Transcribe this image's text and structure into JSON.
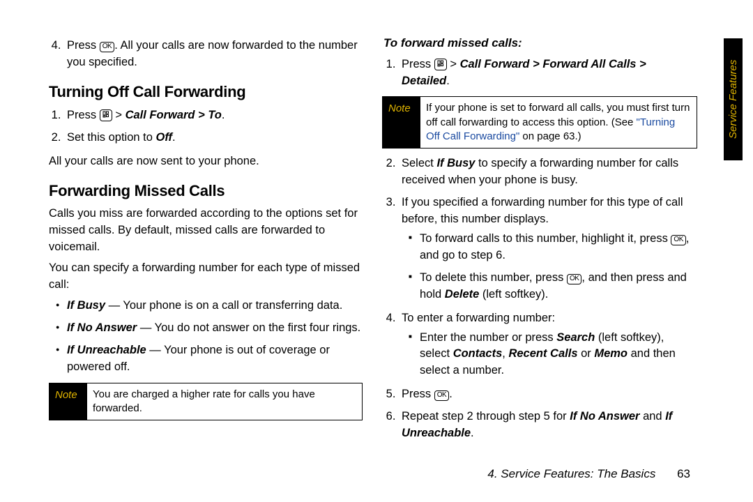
{
  "left": {
    "step4_pre": "Press ",
    "step4_key": "OK",
    "step4_post": ". All your calls are now forwarded to the number you specified.",
    "h_turnoff": "Turning Off Call Forwarding",
    "to_step1_pre": "Press ",
    "to_step1_key": "☐",
    "to_step1_mid": "  > ",
    "to_step1_bi": "Call Forward > To",
    "to_step1_post": ".",
    "to_step2_pre": "Set this option to ",
    "to_step2_bi": "Off",
    "to_step2_post": ".",
    "to_para": "All your calls are now sent to your phone.",
    "h_fmc": "Forwarding Missed Calls",
    "fmc_p1": "Calls you miss are forwarded according to the options set for missed calls. By default, missed calls are forwarded to voicemail.",
    "fmc_p2": "You can specify a forwarding number for each type of missed call:",
    "b1_label": "If Busy",
    "b1_text": " — Your phone is on a call or transferring data.",
    "b2_label": "If No Answer",
    "b2_text": " — You do not answer on the first four rings.",
    "b3_label": "If Unreachable",
    "b3_text": " — Your phone is out of coverage or powered off.",
    "note_label": "Note",
    "note_body": "You are charged a higher rate for calls you have forwarded."
  },
  "right": {
    "subhead": "To forward missed calls:",
    "s1_pre": "Press ",
    "s1_key": "☐",
    "s1_mid": "  > ",
    "s1_bi": "Call Forward > Forward All Calls > Detailed",
    "s1_post": ".",
    "note_label": "Note",
    "note_body_a": "If your phone is set to forward all calls, you must first turn off call forwarding to access this option. (See ",
    "note_body_ref1": "\"",
    "note_body_ref2": "Turning Off Call Forwarding",
    "note_body_ref3": "\"",
    "note_body_b": " on page 63.)",
    "s2_a": "Select ",
    "s2_bi": "If Busy",
    "s2_b": " to specify a forwarding number for calls received when your phone is busy.",
    "s3": "If you specified a forwarding number for this type of call before, this number displays.",
    "s3sq1_a": "To forward calls to this number, highlight it, press ",
    "s3sq1_key": "OK",
    "s3sq1_b": ", and go to step 6.",
    "s3sq2_a": "To delete this number, press ",
    "s3sq2_key": "OK",
    "s3sq2_b": ", and then press and hold ",
    "s3sq2_bi": "Delete",
    "s3sq2_c": " (left softkey).",
    "s4": "To enter a forwarding number:",
    "s4sq_a": "Enter the number or press ",
    "s4sq_bi1": "Search",
    "s4sq_b": " (left softkey), select ",
    "s4sq_bi2": "Contacts",
    "s4sq_c": ", ",
    "s4sq_bi3": "Recent Calls",
    "s4sq_d": " or ",
    "s4sq_bi4": "Memo",
    "s4sq_e": " and then select a number.",
    "s5_a": "Press ",
    "s5_key": "OK",
    "s5_b": ".",
    "s6_a": "Repeat step 2 through step 5 for ",
    "s6_bi1": "If No Answer",
    "s6_b": " and ",
    "s6_bi2": "If Unreachable",
    "s6_c": "."
  },
  "tab": "Service Features",
  "footer_text": "4. Service Features: The Basics",
  "footer_page": "63"
}
